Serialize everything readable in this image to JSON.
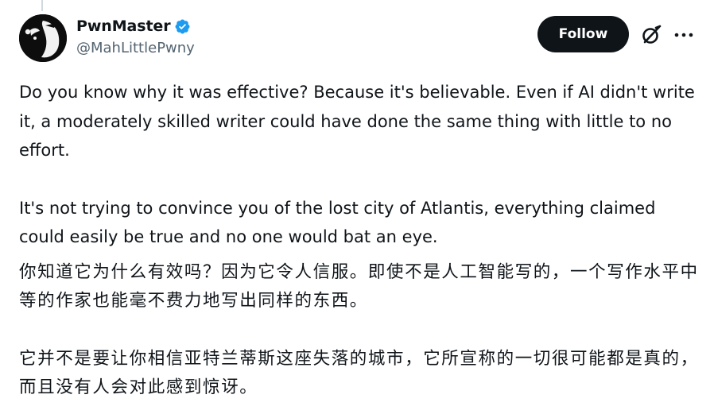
{
  "user": {
    "display_name": "PwnMaster",
    "handle": "@MahLittlePwny",
    "verified": true,
    "verified_color": "#1d9bf0"
  },
  "actions": {
    "follow_label": "Follow",
    "grok_icon": "grok-icon",
    "more_icon": "more-icon"
  },
  "tweet": {
    "paragraphs": [
      "Do you know why it was effective? Because it's believable. Even if AI didn't write it, a moderately skilled writer could have done the same thing with little to no effort.",
      "It's not trying to convince you of the lost city of Atlantis, everything claimed could easily be true and no one would bat an eye."
    ],
    "translation_paragraphs": [
      "你知道它为什么有效吗？因为它令人信服。即使不是人工智能写的，一个写作水平中等的作家也能毫不费力地写出同样的东西。",
      "它并不是要让你相信亚特兰蒂斯这座失落的城市，它所宣称的一切很可能都是真的，而且没有人会对此感到惊讶。"
    ]
  },
  "colors": {
    "text": "#0f1419",
    "secondary": "#536471",
    "follow_bg": "#0f1419",
    "follow_text": "#ffffff"
  }
}
